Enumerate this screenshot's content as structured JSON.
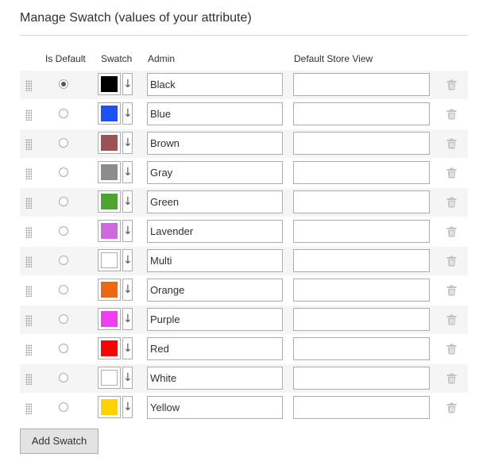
{
  "section": {
    "title": "Manage Swatch (values of your attribute)"
  },
  "columns": {
    "is_default": "Is Default",
    "swatch": "Swatch",
    "admin": "Admin",
    "store_view": "Default Store View"
  },
  "swatches": [
    {
      "admin": "Black",
      "store": "",
      "color": "#000000",
      "default": true
    },
    {
      "admin": "Blue",
      "store": "",
      "color": "#1c52f5",
      "default": false
    },
    {
      "admin": "Brown",
      "store": "",
      "color": "#9a5252",
      "default": false
    },
    {
      "admin": "Gray",
      "store": "",
      "color": "#8c8c8c",
      "default": false
    },
    {
      "admin": "Green",
      "store": "",
      "color": "#4ea42e",
      "default": false
    },
    {
      "admin": "Lavender",
      "store": "",
      "color": "#cd6bdd",
      "default": false
    },
    {
      "admin": "Multi",
      "store": "",
      "color": "#ffffff",
      "default": false
    },
    {
      "admin": "Orange",
      "store": "",
      "color": "#f06710",
      "default": false
    },
    {
      "admin": "Purple",
      "store": "",
      "color": "#ee3ef2",
      "default": false
    },
    {
      "admin": "Red",
      "store": "",
      "color": "#fb0303",
      "default": false
    },
    {
      "admin": "White",
      "store": "",
      "color": "#ffffff",
      "default": false
    },
    {
      "admin": "Yellow",
      "store": "",
      "color": "#ffd200",
      "default": false
    }
  ],
  "icons": {
    "drag": "drag-handle-icon",
    "swatch_arrow": "arrow-down-icon",
    "delete": "trash-icon"
  },
  "add_button": {
    "label": "Add Swatch"
  }
}
